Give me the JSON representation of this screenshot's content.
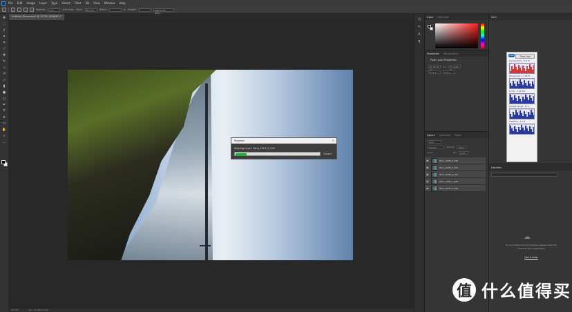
{
  "menubar": {
    "items": [
      "File",
      "Edit",
      "Image",
      "Layer",
      "Type",
      "Select",
      "Filter",
      "3D",
      "View",
      "Window",
      "Help"
    ]
  },
  "options": {
    "feather_label": "Feather:",
    "feather_value": "0 px",
    "antialias_label": "Anti-alias",
    "style_label": "Style:",
    "style_value": "Normal",
    "width_label": "Width:",
    "height_label": "Height:",
    "select_mask_label": "Select and Mask..."
  },
  "document": {
    "tab_title": "Untitled_Panorama1 @ 33.3% (RGB/8*) *",
    "zoom": "33.33%",
    "doc_size": "Doc: 91.9M/0 bytes"
  },
  "dialog": {
    "title": "Progress",
    "message": "Aligning Layer: Pano_22HF_9_092",
    "progress": 0.13,
    "cancel_label": "Cancel",
    "close_glyph": "×"
  },
  "color_panel": {
    "tabs": [
      "Color",
      "Swatches"
    ]
  },
  "properties_panel": {
    "tabs": [
      "Properties",
      "Adjustments"
    ],
    "heading": "Pixel Layer Properties",
    "w": "W: 25.28 in",
    "h": "H: 16.82 in",
    "x": "X: 0 in",
    "y": "Y: 0 in",
    "go": "GO"
  },
  "layers_panel": {
    "tabs": [
      "Layers",
      "Channels",
      "Paths"
    ],
    "kind_label": "Kind",
    "blend_mode": "Normal",
    "opacity_label": "Opacity:",
    "opacity_value": "100%",
    "lock_label": "Lock:",
    "fill_label": "Fill:",
    "fill_value": "100%",
    "layers": [
      {
        "name": "Pano_22HF_9_093"
      },
      {
        "name": "Pano_22HF_9_092"
      },
      {
        "name": "Pano_22HF_9_091"
      },
      {
        "name": "Pano_22HF_9_090"
      },
      {
        "name": "Pano_22HF_9_089"
      }
    ]
  },
  "info_panel": {
    "title": "Intel",
    "gadget_button": "Stop Log",
    "intel_badge": "intel",
    "readouts": [
      "Package Pwr0 : 31.4 W",
      "Package Pwr1 : 4.90 W",
      "IA Freq : 3.20 GHz",
      "Package Temp0 : 56 C",
      "DRAM Pwr : 4.2 W"
    ]
  },
  "libraries_panel": {
    "title": "Libraries",
    "message": "To use Creative Cloud Libraries, please install the Creative Cloud Application",
    "link": "Get it now!"
  },
  "watermark": {
    "badge": "值",
    "text": "什么值得买"
  },
  "colors": {
    "progress_green": "#1fae3a",
    "panel_bg": "#353535",
    "canvas_bg": "#282828",
    "photoshop_blue": "#31a8ff"
  },
  "icons": [
    "photoshop-logo",
    "move-icon",
    "marquee-icon",
    "lasso-icon",
    "magic-wand-icon",
    "crop-icon",
    "eyedropper-icon",
    "healing-icon",
    "brush-icon",
    "stamp-icon",
    "history-brush-icon",
    "eraser-icon",
    "gradient-icon",
    "blur-icon",
    "dodge-icon",
    "pen-icon",
    "type-icon",
    "path-select-icon",
    "rectangle-icon",
    "hand-icon",
    "zoom-icon",
    "eye-icon",
    "cloud-icon"
  ]
}
